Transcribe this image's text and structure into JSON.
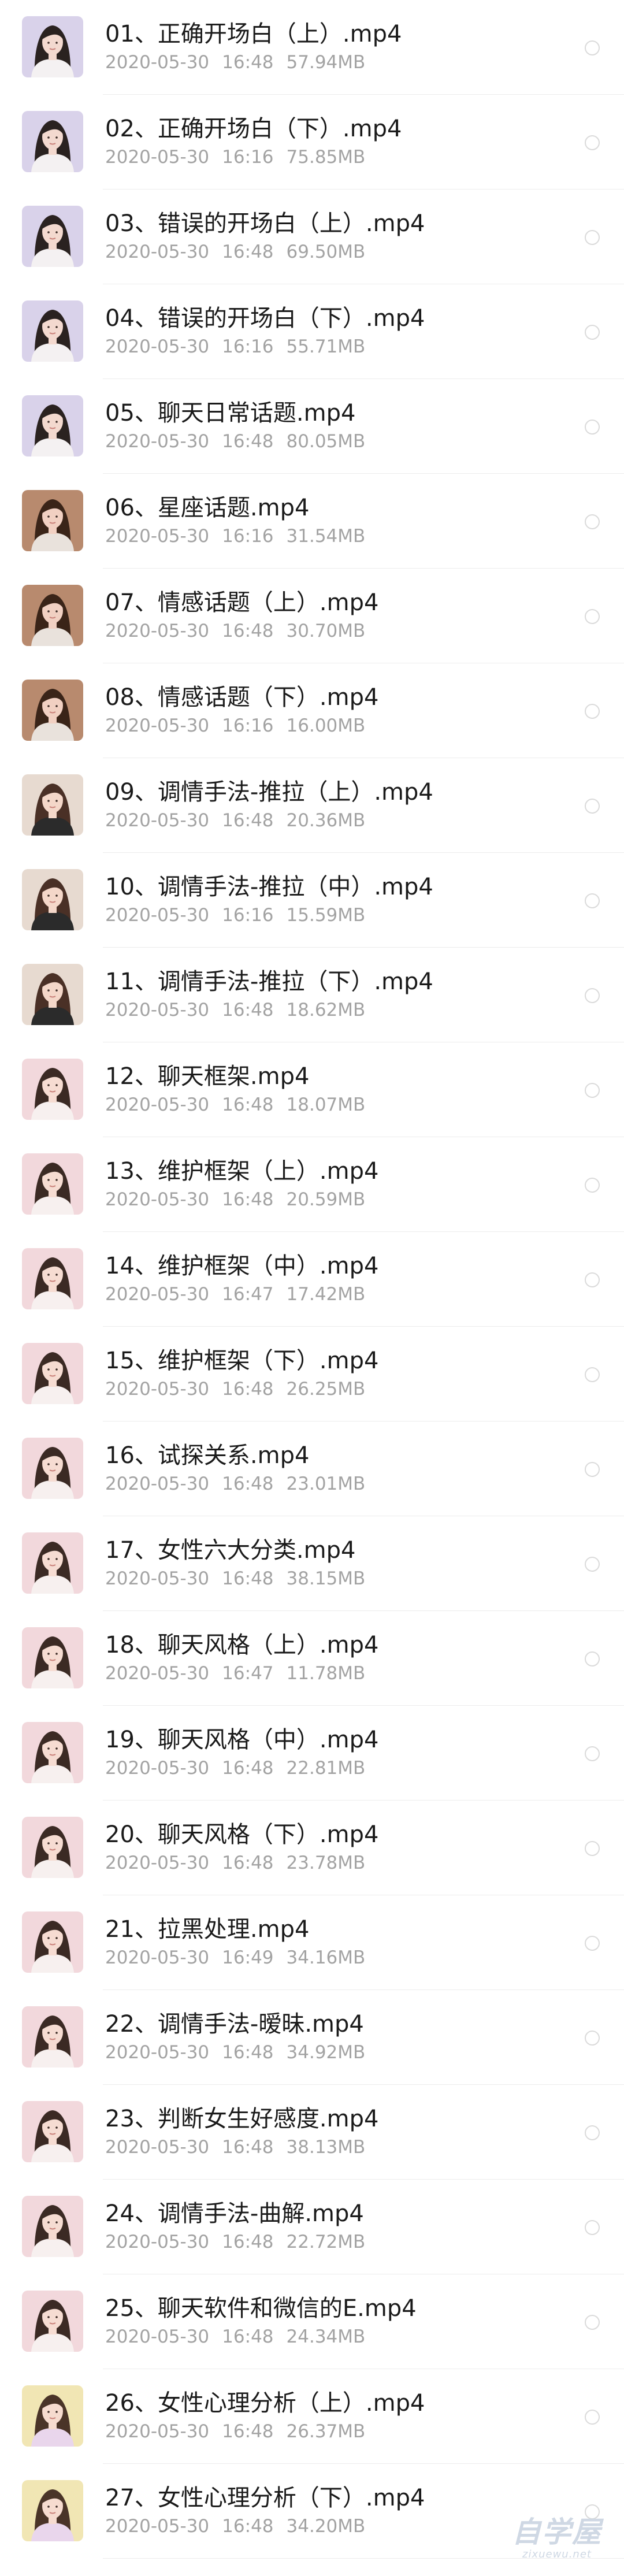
{
  "files": [
    {
      "name": "01、正确开场白（上）.mp4",
      "date": "2020-05-30",
      "time": "16:48",
      "size": "57.94MB",
      "thumb": "lavender",
      "thumb_icon": "video-thumbnail-icon"
    },
    {
      "name": "02、正确开场白（下）.mp4",
      "date": "2020-05-30",
      "time": "16:16",
      "size": "75.85MB",
      "thumb": "lavender",
      "thumb_icon": "video-thumbnail-icon"
    },
    {
      "name": "03、错误的开场白（上）.mp4",
      "date": "2020-05-30",
      "time": "16:48",
      "size": "69.50MB",
      "thumb": "lavender",
      "thumb_icon": "video-thumbnail-icon"
    },
    {
      "name": "04、错误的开场白（下）.mp4",
      "date": "2020-05-30",
      "time": "16:16",
      "size": "55.71MB",
      "thumb": "lavender",
      "thumb_icon": "video-thumbnail-icon"
    },
    {
      "name": "05、聊天日常话题.mp4",
      "date": "2020-05-30",
      "time": "16:48",
      "size": "80.05MB",
      "thumb": "lavender",
      "thumb_icon": "video-thumbnail-icon"
    },
    {
      "name": "06、星座话题.mp4",
      "date": "2020-05-30",
      "time": "16:16",
      "size": "31.54MB",
      "thumb": "brown",
      "thumb_icon": "video-thumbnail-icon"
    },
    {
      "name": "07、情感话题（上）.mp4",
      "date": "2020-05-30",
      "time": "16:48",
      "size": "30.70MB",
      "thumb": "brown",
      "thumb_icon": "video-thumbnail-icon"
    },
    {
      "name": "08、情感话题（下）.mp4",
      "date": "2020-05-30",
      "time": "16:16",
      "size": "16.00MB",
      "thumb": "brown",
      "thumb_icon": "video-thumbnail-icon"
    },
    {
      "name": "09、调情手法-推拉（上）.mp4",
      "date": "2020-05-30",
      "time": "16:48",
      "size": "20.36MB",
      "thumb": "beige",
      "thumb_icon": "video-thumbnail-icon"
    },
    {
      "name": "10、调情手法-推拉（中）.mp4",
      "date": "2020-05-30",
      "time": "16:16",
      "size": "15.59MB",
      "thumb": "beige",
      "thumb_icon": "video-thumbnail-icon"
    },
    {
      "name": "11、调情手法-推拉（下）.mp4",
      "date": "2020-05-30",
      "time": "16:48",
      "size": "18.62MB",
      "thumb": "beige",
      "thumb_icon": "video-thumbnail-icon"
    },
    {
      "name": "12、聊天框架.mp4",
      "date": "2020-05-30",
      "time": "16:48",
      "size": "18.07MB",
      "thumb": "pink",
      "thumb_icon": "video-thumbnail-icon"
    },
    {
      "name": "13、维护框架（上）.mp4",
      "date": "2020-05-30",
      "time": "16:48",
      "size": "20.59MB",
      "thumb": "pink",
      "thumb_icon": "video-thumbnail-icon"
    },
    {
      "name": "14、维护框架（中）.mp4",
      "date": "2020-05-30",
      "time": "16:47",
      "size": "17.42MB",
      "thumb": "pink",
      "thumb_icon": "video-thumbnail-icon"
    },
    {
      "name": "15、维护框架（下）.mp4",
      "date": "2020-05-30",
      "time": "16:48",
      "size": "26.25MB",
      "thumb": "pink",
      "thumb_icon": "video-thumbnail-icon"
    },
    {
      "name": "16、试探关系.mp4",
      "date": "2020-05-30",
      "time": "16:48",
      "size": "23.01MB",
      "thumb": "pink",
      "thumb_icon": "video-thumbnail-icon"
    },
    {
      "name": "17、女性六大分类.mp4",
      "date": "2020-05-30",
      "time": "16:48",
      "size": "38.15MB",
      "thumb": "pink",
      "thumb_icon": "video-thumbnail-icon"
    },
    {
      "name": "18、聊天风格（上）.mp4",
      "date": "2020-05-30",
      "time": "16:47",
      "size": "11.78MB",
      "thumb": "pink",
      "thumb_icon": "video-thumbnail-icon"
    },
    {
      "name": "19、聊天风格（中）.mp4",
      "date": "2020-05-30",
      "time": "16:48",
      "size": "22.81MB",
      "thumb": "pink",
      "thumb_icon": "video-thumbnail-icon"
    },
    {
      "name": "20、聊天风格（下）.mp4",
      "date": "2020-05-30",
      "time": "16:48",
      "size": "23.78MB",
      "thumb": "pink",
      "thumb_icon": "video-thumbnail-icon"
    },
    {
      "name": "21、拉黑处理.mp4",
      "date": "2020-05-30",
      "time": "16:49",
      "size": "34.16MB",
      "thumb": "pink",
      "thumb_icon": "video-thumbnail-icon"
    },
    {
      "name": "22、调情手法-暧昧.mp4",
      "date": "2020-05-30",
      "time": "16:48",
      "size": "34.92MB",
      "thumb": "pink",
      "thumb_icon": "video-thumbnail-icon"
    },
    {
      "name": "23、判断女生好感度.mp4",
      "date": "2020-05-30",
      "time": "16:48",
      "size": "38.13MB",
      "thumb": "pink",
      "thumb_icon": "video-thumbnail-icon"
    },
    {
      "name": "24、调情手法-曲解.mp4",
      "date": "2020-05-30",
      "time": "16:48",
      "size": "22.72MB",
      "thumb": "pink",
      "thumb_icon": "video-thumbnail-icon"
    },
    {
      "name": "25、聊天软件和微信的E.mp4",
      "date": "2020-05-30",
      "time": "16:48",
      "size": "24.34MB",
      "thumb": "pink",
      "thumb_icon": "video-thumbnail-icon"
    },
    {
      "name": "26、女性心理分析（上）.mp4",
      "date": "2020-05-30",
      "time": "16:48",
      "size": "26.37MB",
      "thumb": "yellow",
      "thumb_icon": "video-thumbnail-icon"
    },
    {
      "name": "27、女性心理分析（下）.mp4",
      "date": "2020-05-30",
      "time": "16:48",
      "size": "34.20MB",
      "thumb": "yellow",
      "thumb_icon": "video-thumbnail-icon"
    }
  ],
  "thumb_palettes": {
    "lavender": {
      "bg": "#d9d2ea",
      "hair": "#2a2220",
      "skin": "#f3d9cf",
      "top": "#f4f1f2"
    },
    "brown": {
      "bg": "#b88a6e",
      "hair": "#3a2418",
      "skin": "#f1d0c2",
      "top": "#e9e2dc"
    },
    "beige": {
      "bg": "#e7dad0",
      "hair": "#4a3026",
      "skin": "#f4d7c9",
      "top": "#2b2b2b"
    },
    "pink": {
      "bg": "#f2d8dc",
      "hair": "#3b2a24",
      "skin": "#f6dcd2",
      "top": "#f7f0ef"
    },
    "yellow": {
      "bg": "#f1e6b4",
      "hair": "#4a3428",
      "skin": "#f6dbcf",
      "top": "#e9d6ec"
    }
  },
  "colors": {
    "text_primary": "#1a1a1a",
    "text_secondary": "#a3a3a3",
    "divider": "#ececec",
    "radio_border": "#dadada"
  },
  "watermark": {
    "title": "自学屋",
    "subtitle": "zixuewu.net"
  }
}
